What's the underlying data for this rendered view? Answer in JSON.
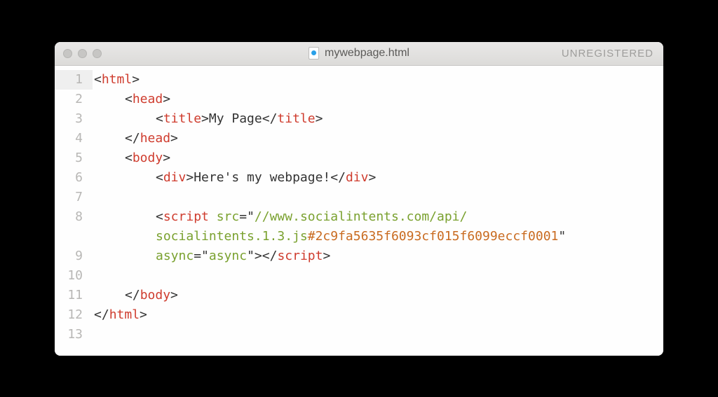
{
  "window": {
    "filename": "mywebpage.html",
    "status": "UNREGISTERED"
  },
  "gutter": {
    "l1": "1",
    "l2": "2",
    "l3": "3",
    "l4": "4",
    "l5": "5",
    "l6": "6",
    "l7": "7",
    "l8": "8",
    "l9": "9",
    "l10": "10",
    "l11": "11",
    "l12": "12",
    "l13": "13"
  },
  "code": {
    "lt": "<",
    "gt": ">",
    "lts": "</",
    "q": "\"",
    "eq": "=",
    "html": "html",
    "head": "head",
    "title": "title",
    "body": "body",
    "div": "div",
    "script": "script",
    "title_text": "My Page",
    "div_text": "Here's my webpage!",
    "attr_src": "src",
    "attr_async": "async",
    "async_val": "async",
    "src_part1": "//www.socialintents.com/api/",
    "src_part2": "socialintents.1.3.js",
    "src_hash": "#2c9fa5635f6093cf015f6099eccf0001",
    "sp": " "
  }
}
